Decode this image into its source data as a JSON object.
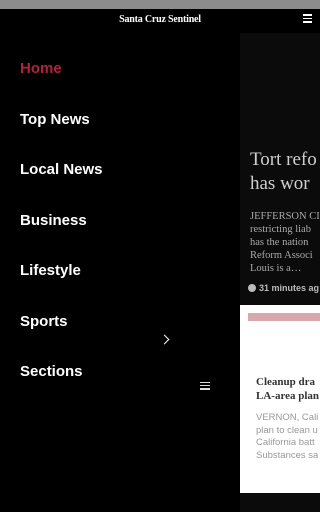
{
  "header": {
    "brand": "Santa Cruz Sentinel",
    "menu_icon": "hamburger-icon"
  },
  "nav": {
    "items": [
      {
        "label": "Home",
        "active": true
      },
      {
        "label": "Top News"
      },
      {
        "label": "Local News"
      },
      {
        "label": "Business"
      },
      {
        "label": "Lifestyle"
      },
      {
        "label": "Sports"
      },
      {
        "label": "Sections",
        "icon": "chevron-right-icon"
      }
    ],
    "settings_icon": "sliders-icon"
  },
  "preview": {
    "headline": "Tort refo\nhas wor",
    "snippet": "JEFFERSON CI\nrestricting liab\nhas the nation\nReform Associ\nLouis is a…",
    "time": "31 minutes ag",
    "time_icon": "clock-icon",
    "card": {
      "accent_color": "#d9a7ae",
      "headline": "Cleanup dra\nLA-area plan",
      "snippet": "VERNON, Cali\nplan to clean u\nCalifornia batt\nSubstances sa"
    }
  },
  "colors": {
    "active": "#b0243b",
    "background": "#000000"
  }
}
